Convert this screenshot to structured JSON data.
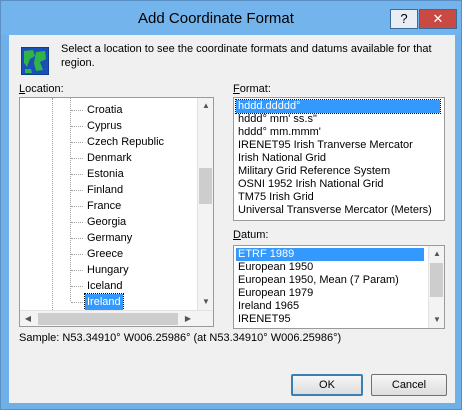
{
  "window": {
    "title": "Add Coordinate Format",
    "help_label": "?",
    "close_label": "✕"
  },
  "intro": "Select a location to see the coordinate formats and datums available for that region.",
  "location": {
    "label_prefix": "",
    "label_ul": "L",
    "label_rest": "ocation:",
    "items": [
      "Croatia",
      "Cyprus",
      "Czech Republic",
      "Denmark",
      "Estonia",
      "Finland",
      "France",
      "Georgia",
      "Germany",
      "Greece",
      "Hungary",
      "Iceland",
      "Ireland"
    ],
    "selected": "Ireland"
  },
  "format": {
    "label_ul": "F",
    "label_rest": "ormat:",
    "items": [
      "hddd.ddddd°",
      "hddd° mm' ss.s\"",
      "hddd° mm.mmm'",
      "IRENET95 Irish Tranverse Mercator",
      "Irish National Grid",
      "Military Grid Reference System",
      "OSNI 1952 Irish National Grid",
      "TM75 Irish Grid",
      "Universal Transverse Mercator (Meters)"
    ],
    "selected": "hddd.ddddd°"
  },
  "datum": {
    "label_ul": "D",
    "label_rest": "atum:",
    "items": [
      "ETRF 1989",
      "European 1950",
      "European 1950, Mean (7 Param)",
      "European 1979",
      "Ireland 1965",
      "IRENET95"
    ],
    "selected": "ETRF 1989"
  },
  "sample": "Sample: N53.34910°  W006.25986° (at N53.34910°  W006.25986°)",
  "buttons": {
    "ok": "OK",
    "cancel": "Cancel"
  }
}
